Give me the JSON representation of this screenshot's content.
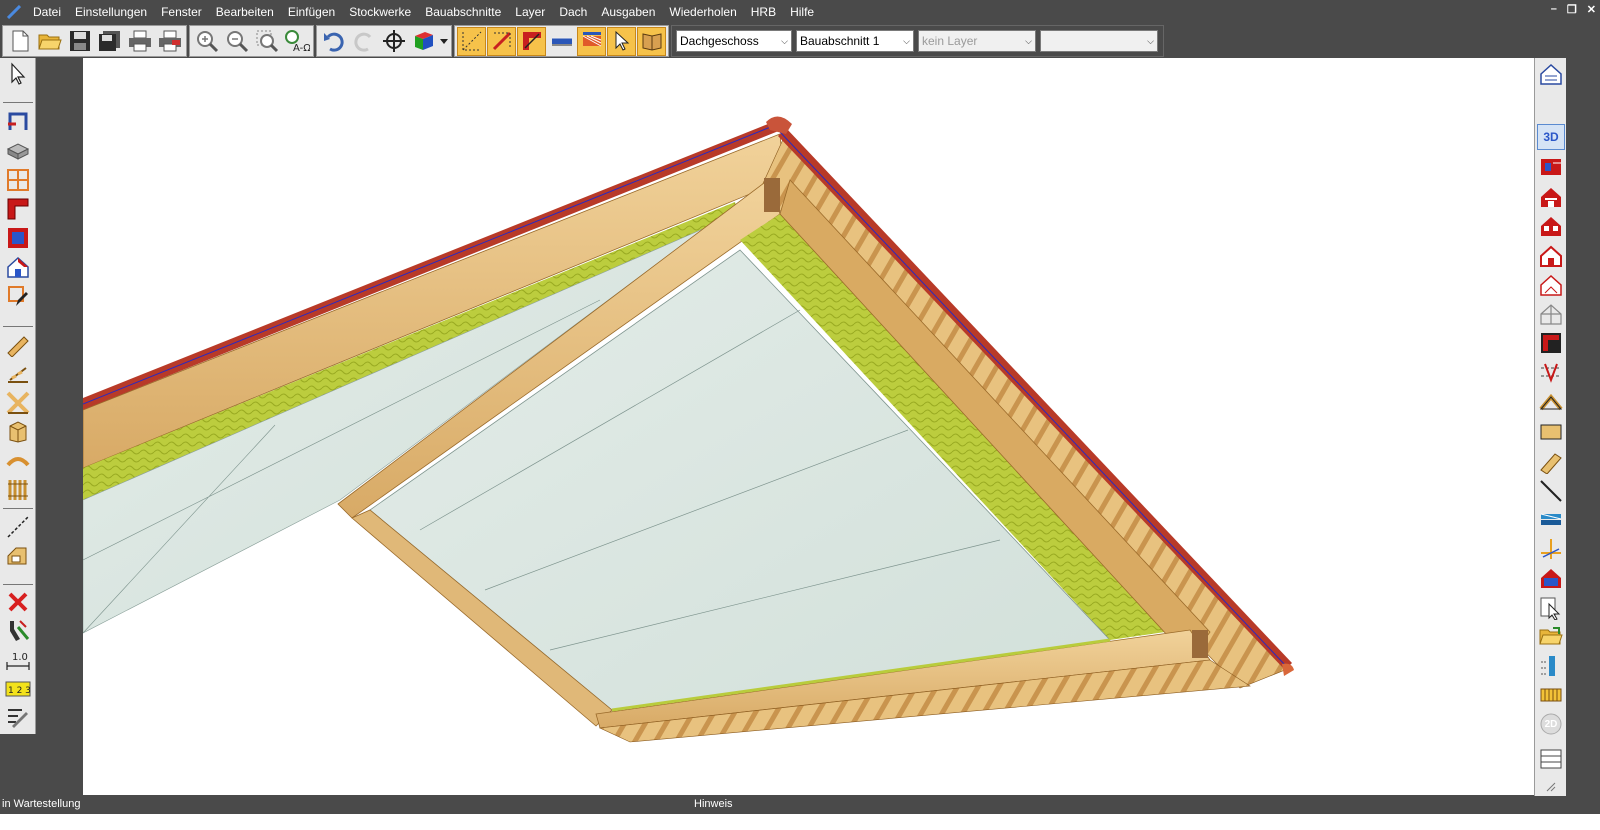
{
  "menu": {
    "items": [
      "Datei",
      "Einstellungen",
      "Fenster",
      "Bearbeiten",
      "Einfügen",
      "Stockwerke",
      "Bauabschnitte",
      "Layer",
      "Dach",
      "Ausgaben",
      "Wiederholen",
      "HRB",
      "Hilfe"
    ]
  },
  "toolbar": {
    "floor_select": "Dachgeschoss",
    "section_select": "Bauabschnitt 1",
    "layer_select": "kein Layer",
    "extra_select": ""
  },
  "right_tools": {
    "view3d_label": "3D",
    "view2d_label": "2D"
  },
  "left_tools": {
    "numbering_label": "1 2 3",
    "dimension_label": "1.0"
  },
  "statusbar": {
    "left_text": "in Wartestellung",
    "mid_text": "Hinweis"
  },
  "colors": {
    "chrome": "#4a4a4a",
    "panel": "#e9e9e9",
    "viewport": "#ffffff",
    "timber": "#e9c489",
    "insulation": "#b9cc3c",
    "roof_board": "#d9e6e1",
    "tile": "#b8402a"
  }
}
